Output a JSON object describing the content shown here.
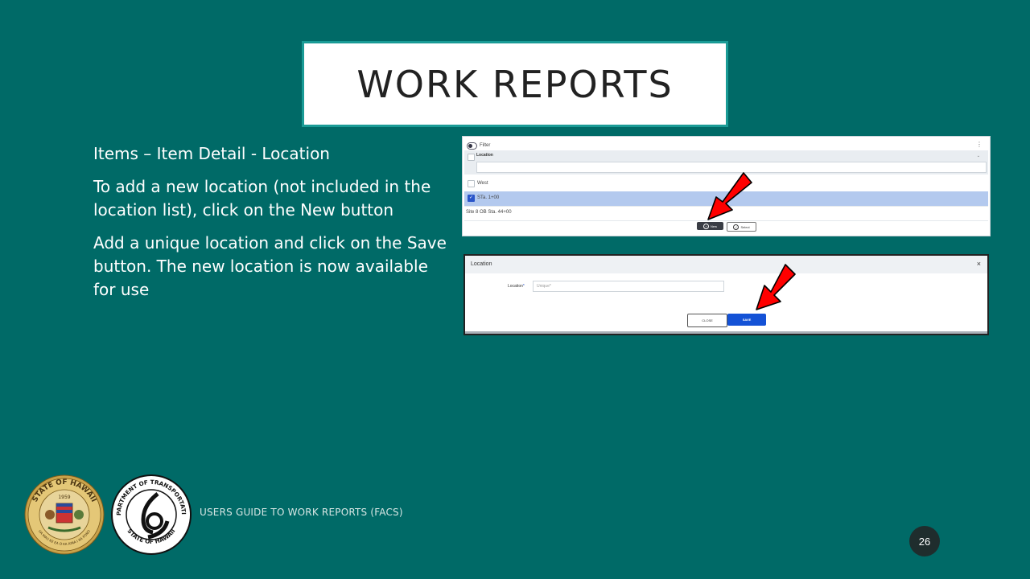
{
  "slide": {
    "title": "WORK REPORTS",
    "bullets": [
      "Items – Item Detail - Location",
      "To add a new location (not included in the location list), click on the New button",
      "Add a unique location and click on the Save button.  The new location is now available for use"
    ],
    "footer": "USERS GUIDE TO WORK REPORTS  (FACS)",
    "page_number": "26"
  },
  "location_list": {
    "filter_label": "Filter",
    "kebab": "⋮",
    "column_header": "Location",
    "column_caret": "⌄",
    "rows": [
      {
        "label": "West",
        "selected": false
      },
      {
        "label": "STa. 1+00",
        "selected": true
      },
      {
        "label": "Site 8 OB Sta. 44+00",
        "selected": false
      }
    ],
    "new_button": "New",
    "select_button": "Select"
  },
  "location_dialog": {
    "title": "Location",
    "close_icon": "×",
    "field_label": "Location",
    "required_mark": "*",
    "field_placeholder": "Unique*",
    "close_button": "CLOSE",
    "save_button": "SAVE"
  },
  "seal_hawaii": {
    "ring_text": "STATE OF HAWAII",
    "year": "1959",
    "motto": "UA MAU KE EA O KA AINA I KA PONO"
  },
  "seal_dot": {
    "ring_text_top": "DEPARTMENT OF TRANSPORTATION",
    "ring_text_bottom": "STATE OF HAWAII"
  },
  "colors": {
    "background": "#006a67",
    "title_border": "#1a9b96",
    "selected_row": "#b3c9ee",
    "save_blue": "#1452d6",
    "arrow_red": "#ff0000"
  }
}
